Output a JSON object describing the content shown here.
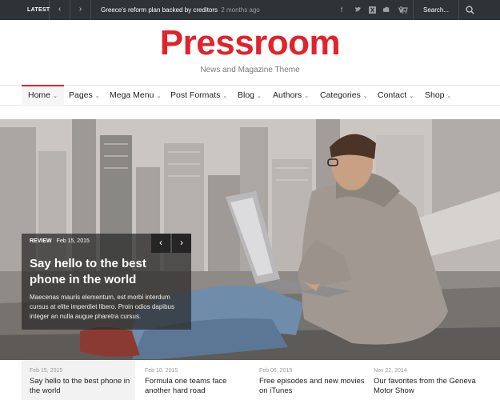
{
  "topbar": {
    "latest_label": "LATEST",
    "prev_icon": "chevron-left-icon",
    "next_icon": "chevron-right-icon",
    "ticker_title": "Greece's reform plan backed by creditors",
    "ticker_ago": "2 months ago",
    "social_icons": [
      "facebook-icon",
      "twitter-icon",
      "xing-icon",
      "flickr-icon",
      "skype-icon",
      "cart-icon"
    ],
    "search_label": "Search..."
  },
  "header": {
    "logo": "Pressroom",
    "tagline": "News and Magazine Theme"
  },
  "nav": {
    "items": [
      {
        "label": "Home",
        "caret": "⌄"
      },
      {
        "label": "Pages",
        "caret": "⌄"
      },
      {
        "label": "Mega Menu",
        "caret": "⌄"
      },
      {
        "label": "Post Formats",
        "caret": "⌄"
      },
      {
        "label": "Blog",
        "caret": "⌄"
      },
      {
        "label": "Authors",
        "caret": "⌄"
      },
      {
        "label": "Categories",
        "caret": "⌄"
      },
      {
        "label": "Contact",
        "caret": "⌄"
      },
      {
        "label": "Shop",
        "caret": "⌄"
      }
    ]
  },
  "hero": {
    "category": "REVIEW",
    "date": "Feb 15, 2015",
    "title": "Say hello to the best phone in the world",
    "description": "Maecenas mauris elementum, est morbi interdum cursus at elite imperdiet libero. Proin odios dapibus integer an nulla augue pharetra cursus.",
    "prev": "‹",
    "next": "›"
  },
  "posts": [
    {
      "date": "Feb 15, 2015",
      "title": "Say hello to the best phone in the world"
    },
    {
      "date": "Feb 10, 2015",
      "title": "Formula one teams face another hard road"
    },
    {
      "date": "Feb 06, 2015",
      "title": "Free episodes and new movies on iTunes"
    },
    {
      "date": "Nov 22, 2014",
      "title": "Our favorites from the Geneva Motor Show"
    }
  ],
  "colors": {
    "brand": "#e0232c",
    "topbar": "#2e3338"
  }
}
